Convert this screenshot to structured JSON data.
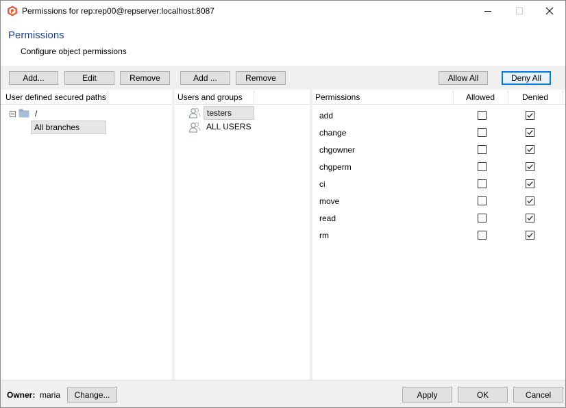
{
  "window": {
    "title": "Permissions for rep:rep00@repserver:localhost:8087",
    "icon": "app-logo-icon",
    "accent_color": "#e4572e"
  },
  "header": {
    "title": "Permissions",
    "subtitle": "Configure object permissions"
  },
  "paths_panel": {
    "buttons": {
      "add": "Add...",
      "edit": "Edit",
      "remove": "Remove"
    },
    "column_header": "User defined secured paths",
    "tree": {
      "root_label": "/",
      "selected_child": "All branches"
    }
  },
  "users_panel": {
    "buttons": {
      "add": "Add ...",
      "remove": "Remove"
    },
    "column_header": "Users and groups",
    "items": [
      {
        "label": "testers",
        "selected": true,
        "icon": "group-icon"
      },
      {
        "label": "ALL USERS",
        "selected": false,
        "icon": "group-icon"
      }
    ]
  },
  "permissions_panel": {
    "buttons": {
      "allow_all": "Allow All",
      "deny_all": "Deny All"
    },
    "columns": {
      "name": "Permissions",
      "allowed": "Allowed",
      "denied": "Denied"
    },
    "rows": [
      {
        "name": "add",
        "allowed": false,
        "denied": true
      },
      {
        "name": "change",
        "allowed": false,
        "denied": true
      },
      {
        "name": "chgowner",
        "allowed": false,
        "denied": true
      },
      {
        "name": "chgperm",
        "allowed": false,
        "denied": true
      },
      {
        "name": "ci",
        "allowed": false,
        "denied": true
      },
      {
        "name": "move",
        "allowed": false,
        "denied": true
      },
      {
        "name": "read",
        "allowed": false,
        "denied": true
      },
      {
        "name": "rm",
        "allowed": false,
        "denied": true
      }
    ]
  },
  "footer": {
    "owner_label": "Owner:",
    "owner_value": "maria",
    "change_button": "Change...",
    "apply_button": "Apply",
    "ok_button": "OK",
    "cancel_button": "Cancel"
  }
}
